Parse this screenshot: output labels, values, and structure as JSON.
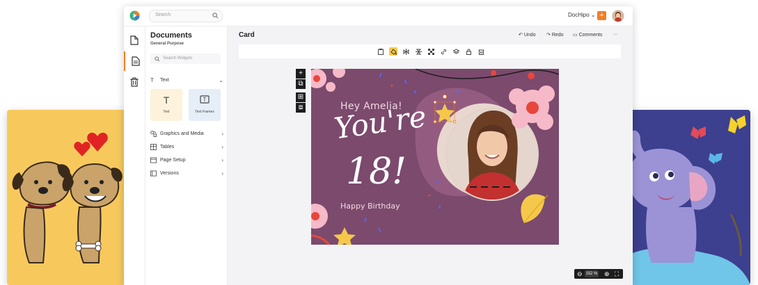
{
  "app": {
    "search_placeholder": "Search",
    "brand_menu": "DocHipo",
    "brand_menu_chevron": "⌄",
    "add_label": "+"
  },
  "panel": {
    "title": "Documents",
    "subtitle": "General Purpose",
    "widget_search_placeholder": "Search Widgets",
    "text_section": "Text",
    "tiles": [
      {
        "label": "Text",
        "bg": "#fdf3dc"
      },
      {
        "label": "Text Frames",
        "bg": "#e6eef8"
      }
    ],
    "sections": [
      {
        "label": "Graphics and Media"
      },
      {
        "label": "Tables"
      },
      {
        "label": "Page Setup"
      },
      {
        "label": "Versions"
      }
    ]
  },
  "workspace": {
    "title": "Card",
    "undo": "Undo",
    "redo": "Redo",
    "comments": "Comments",
    "more": "···"
  },
  "card": {
    "greeting": "Hey Amelia!",
    "headline": "You're",
    "age": "18!",
    "footer": "Happy Birthday"
  },
  "zoom": {
    "value": "152 %"
  },
  "colors": {
    "accent": "#f07e26",
    "toolbar_highlight": "#f7c94b",
    "card_bg": "#7b4a6d",
    "left_art_bg": "#f7c95d",
    "right_art_bg": "#3d3f8f"
  }
}
